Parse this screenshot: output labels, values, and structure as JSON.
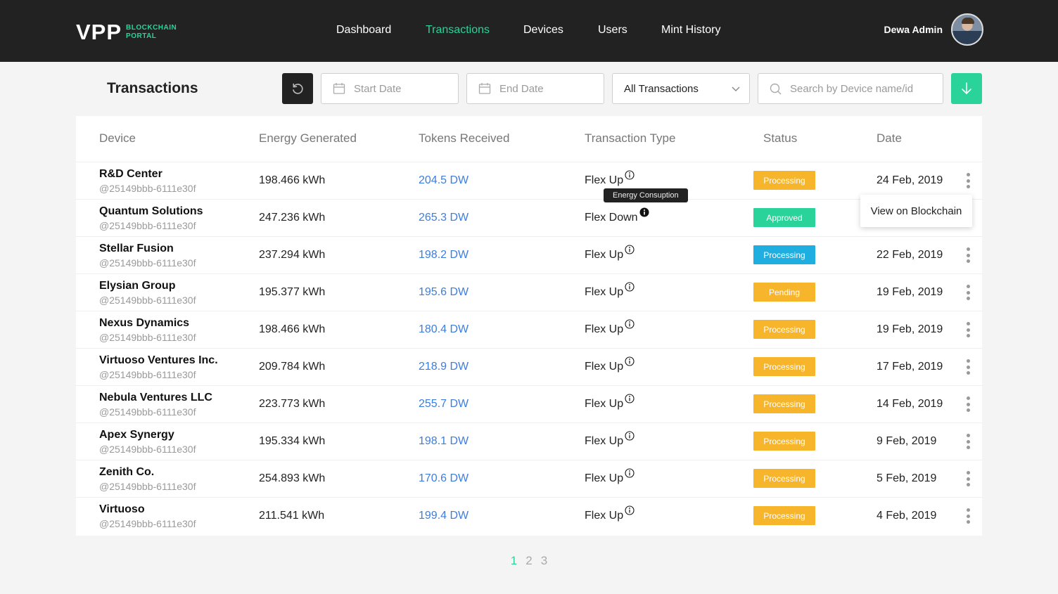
{
  "brand": {
    "main": "VPP",
    "sub_line1": "BLOCKCHAIN",
    "sub_line2": "PORTAL",
    "accent": "#2ad39a"
  },
  "nav": [
    {
      "label": "Dashboard",
      "active": false
    },
    {
      "label": "Transactions",
      "active": true
    },
    {
      "label": "Devices",
      "active": false
    },
    {
      "label": "Users",
      "active": false
    },
    {
      "label": "Mint History",
      "active": false
    }
  ],
  "user": {
    "name": "Dewa Admin"
  },
  "page": {
    "title": "Transactions"
  },
  "toolbar": {
    "refresh_icon": "refresh-icon",
    "start_placeholder": "Start Date",
    "end_placeholder": "End Date",
    "type_selected": "All Transactions",
    "search_placeholder": "Search by Device name/id",
    "download_icon": "download-icon"
  },
  "table": {
    "headers": [
      "Device",
      "Energy Generated",
      "Tokens Received",
      "Transaction Type",
      "Status",
      "Date"
    ],
    "rows": [
      {
        "name": "R&D Center",
        "id": "@25149bbb-6111e30f",
        "energy": "198.466 kWh",
        "tokens": "204.5 DW",
        "type": "Flex Up",
        "status": "Processing",
        "status_color": "#f7b52c",
        "date": "24 Feb, 2019"
      },
      {
        "name": "Quantum Solutions",
        "id": "@25149bbb-6111e30f",
        "energy": "247.236 kWh",
        "tokens": "265.3 DW",
        "type": "Flex Down",
        "status": "Approved",
        "status_color": "#2ad39a",
        "date": ""
      },
      {
        "name": "Stellar Fusion",
        "id": "@25149bbb-6111e30f",
        "energy": "237.294 kWh",
        "tokens": "198.2 DW",
        "type": "Flex Up",
        "status": "Processing",
        "status_color": "#1eaee0",
        "date": "22 Feb, 2019"
      },
      {
        "name": "Elysian Group",
        "id": "@25149bbb-6111e30f",
        "energy": "195.377 kWh",
        "tokens": "195.6 DW",
        "type": "Flex Up",
        "status": "Pending",
        "status_color": "#f7b52c",
        "date": "19 Feb, 2019"
      },
      {
        "name": "Nexus Dynamics",
        "id": "@25149bbb-6111e30f",
        "energy": "198.466 kWh",
        "tokens": "180.4 DW",
        "type": "Flex Up",
        "status": "Processing",
        "status_color": "#f7b52c",
        "date": "19 Feb, 2019"
      },
      {
        "name": "Virtuoso Ventures Inc.",
        "id": "@25149bbb-6111e30f",
        "energy": "209.784 kWh",
        "tokens": "218.9 DW",
        "type": "Flex Up",
        "status": "Processing",
        "status_color": "#f7b52c",
        "date": "17 Feb, 2019"
      },
      {
        "name": "Nebula Ventures LLC",
        "id": "@25149bbb-6111e30f",
        "energy": "223.773 kWh",
        "tokens": "255.7 DW",
        "type": "Flex Up",
        "status": "Processing",
        "status_color": "#f7b52c",
        "date": "14 Feb, 2019"
      },
      {
        "name": "Apex Synergy",
        "id": "@25149bbb-6111e30f",
        "energy": "195.334 kWh",
        "tokens": "198.1 DW",
        "type": "Flex Up",
        "status": "Processing",
        "status_color": "#f7b52c",
        "date": "9 Feb, 2019"
      },
      {
        "name": "Zenith  Co.",
        "id": "@25149bbb-6111e30f",
        "energy": "254.893 kWh",
        "tokens": "170.6 DW",
        "type": "Flex Up",
        "status": "Processing",
        "status_color": "#f7b52c",
        "date": "5 Feb, 2019"
      },
      {
        "name": "Virtuoso",
        "id": "@25149bbb-6111e30f",
        "energy": "211.541 kWh",
        "tokens": "199.4 DW",
        "type": "Flex Up",
        "status": "Processing",
        "status_color": "#f7b52c",
        "date": "4 Feb, 2019"
      }
    ]
  },
  "tooltip": {
    "text": "Energy Consuption"
  },
  "context_menu": {
    "item": "View on Blockchain"
  },
  "pagination": {
    "pages": [
      "1",
      "2",
      "3"
    ],
    "current": "1"
  }
}
